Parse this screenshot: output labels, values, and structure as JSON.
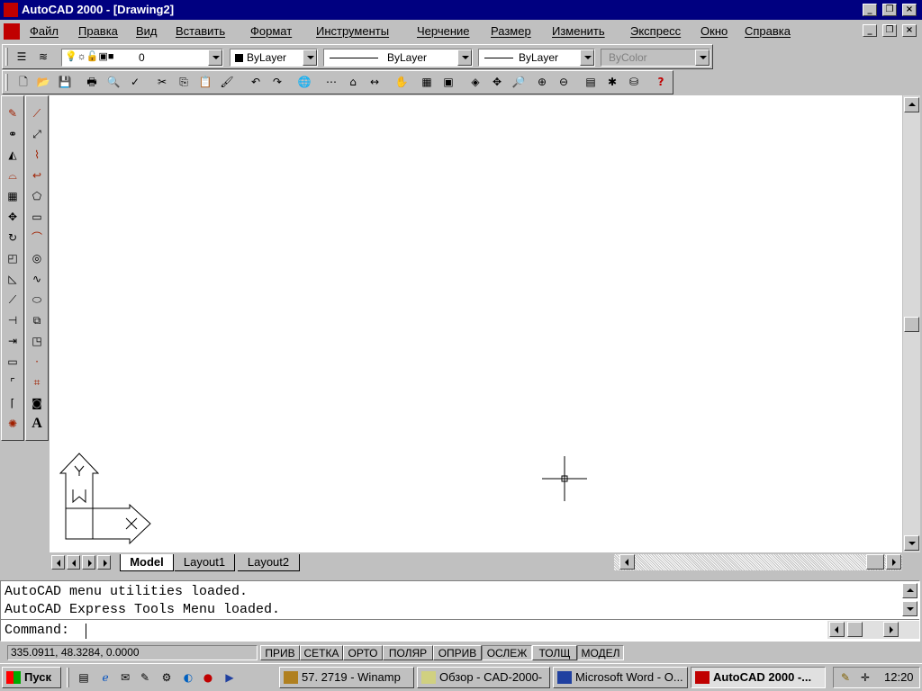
{
  "window": {
    "title": "AutoCAD 2000 - [Drawing2]",
    "accent": "#000080"
  },
  "menu": [
    "Файл",
    "Правка",
    "Вид",
    "Вставить",
    "Формат",
    "Инструменты",
    "Черчение",
    "Размер",
    "Изменить",
    "Экспресс",
    "Окно",
    "Справка"
  ],
  "properties_toolbar": {
    "layer": "0",
    "color": "ByLayer",
    "linetype": "ByLayer",
    "lineweight": "ByLayer",
    "plotstyle": "ByColor"
  },
  "standard_toolbar_icons": [
    "new-icon",
    "open-icon",
    "save-icon",
    "print-icon",
    "preview-icon",
    "spell-icon",
    "cut-icon",
    "copy-icon",
    "paste-icon",
    "match-icon",
    "undo-icon",
    "redo-icon",
    "hyperlink-icon",
    "snap-icon",
    "ucs-icon",
    "distance-icon",
    "pan-icon",
    "zoom-icon"
  ],
  "tabs": [
    "Model",
    "Layout1",
    "Layout2"
  ],
  "command": {
    "history": [
      "AutoCAD menu utilities loaded.",
      "AutoCAD Express Tools Menu loaded."
    ],
    "prompt": "Command:"
  },
  "status": {
    "coords": "335.0911, 48.3284, 0.0000",
    "toggles": [
      "ПРИВ",
      "СЕТКА",
      "ОРТО",
      "ПОЛЯР",
      "ОПРИВ",
      "ОСЛЕЖ",
      "ТОЛЩ",
      "МОДЕЛ"
    ]
  },
  "ucs": {
    "x_label": "X",
    "y_label": "Y",
    "w_label": "W"
  },
  "taskbar": {
    "start": "Пуск",
    "tasks": [
      "57. 2719 - Winamp",
      "Обзор - CAD-2000-",
      "Microsoft Word - O...",
      "AutoCAD 2000 -..."
    ],
    "clock": "12:20"
  }
}
